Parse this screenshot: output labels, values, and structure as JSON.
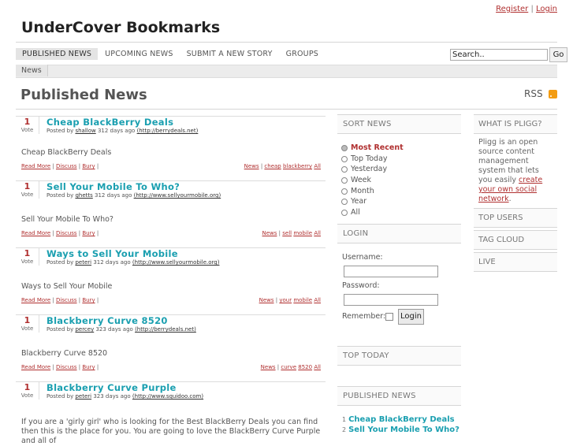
{
  "header": {
    "register": "Register",
    "separator": "|",
    "login": "Login",
    "site_title": "UnderCover Bookmarks"
  },
  "nav": {
    "items": [
      "PUBLISHED NEWS",
      "UPCOMING NEWS",
      "SUBMIT A NEW STORY",
      "GROUPS"
    ]
  },
  "search": {
    "value": "Search..",
    "go_label": "Go"
  },
  "subnav": {
    "tab": "News"
  },
  "page": {
    "title": "Published News",
    "rss_label": "RSS"
  },
  "stories": [
    {
      "votes": "1",
      "vote_label": "Vote",
      "title": "Cheap BlackBerry Deals",
      "posted_by": "Posted by",
      "user": "shallow",
      "age": "312 days ago",
      "url": "(http://berrydeals.net)",
      "desc": "Cheap BlackBerry Deals",
      "read_more": "Read More",
      "discuss": "Discuss",
      "bury": "Bury",
      "category": "News",
      "tags": [
        "cheap",
        "blackberry"
      ],
      "all": "All"
    },
    {
      "votes": "1",
      "vote_label": "Vote",
      "title": "Sell Your Mobile To Who?",
      "posted_by": "Posted by",
      "user": "ghetts",
      "age": "312 days ago",
      "url": "(http://www.sellyourmobile.org)",
      "desc": "Sell Your Mobile To Who?",
      "read_more": "Read More",
      "discuss": "Discuss",
      "bury": "Bury",
      "category": "News",
      "tags": [
        "sell",
        "mobile"
      ],
      "all": "All"
    },
    {
      "votes": "1",
      "vote_label": "Vote",
      "title": "Ways to Sell Your Mobile",
      "posted_by": "Posted by",
      "user": "peteri",
      "age": "312 days ago",
      "url": "(http://www.sellyourmobile.org)",
      "desc": "Ways to Sell Your Mobile",
      "read_more": "Read More",
      "discuss": "Discuss",
      "bury": "Bury",
      "category": "News",
      "tags": [
        "your",
        "mobile"
      ],
      "all": "All"
    },
    {
      "votes": "1",
      "vote_label": "Vote",
      "title": "Blackberry Curve 8520",
      "posted_by": "Posted by",
      "user": "percey",
      "age": "323 days ago",
      "url": "(http://berrydeals.net)",
      "desc": "Blackberry Curve 8520",
      "read_more": "Read More",
      "discuss": "Discuss",
      "bury": "Bury",
      "category": "News",
      "tags": [
        "curve",
        "8520"
      ],
      "all": "All"
    },
    {
      "votes": "1",
      "vote_label": "Vote",
      "title": "Blackberry Curve Purple",
      "posted_by": "Posted by",
      "user": "peteri",
      "age": "323 days ago",
      "url": "(http://www.squidoo.com)",
      "desc": "If you are a 'girly girl' who is looking for the Best BlackBerry Deals you can find then this is the place for you. You are going to love the BlackBerry Curve Purple and all of"
    }
  ],
  "sort_news": {
    "heading": "SORT NEWS",
    "options": [
      "Most Recent",
      "Top Today",
      "Yesterday",
      "Week",
      "Month",
      "Year",
      "All"
    ]
  },
  "login_box": {
    "heading": "LOGIN",
    "username_label": "Username:",
    "password_label": "Password:",
    "remember_label": "Remember:",
    "button": "Login"
  },
  "top_today": {
    "heading": "TOP TODAY"
  },
  "published_news": {
    "heading": "PUBLISHED NEWS",
    "items": [
      {
        "n": "1",
        "title": "Cheap BlackBerry Deals"
      },
      {
        "n": "2",
        "title": "Sell Your Mobile To Who?"
      }
    ]
  },
  "right_col": {
    "what_is_heading": "WHAT IS PLIGG?",
    "what_is_text": "Pligg is an open source content management system that lets you easily",
    "what_is_link": "create your own social network",
    "what_is_end": ".",
    "top_users": "TOP USERS",
    "tag_cloud": "TAG CLOUD",
    "live": "LIVE"
  }
}
